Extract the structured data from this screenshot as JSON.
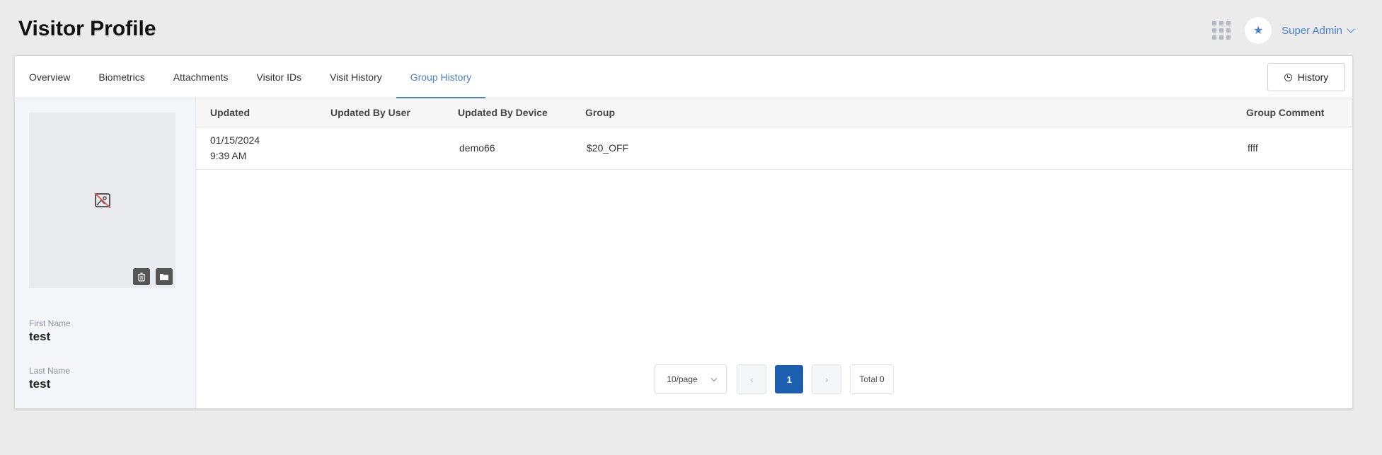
{
  "page": {
    "title": "Visitor Profile"
  },
  "topbar": {
    "apps_icon": "grid-icon",
    "favorite_icon": "star-icon",
    "user_label": "Super Admin"
  },
  "tabs": [
    {
      "label": "Overview"
    },
    {
      "label": "Biometrics"
    },
    {
      "label": "Attachments"
    },
    {
      "label": "Visitor IDs"
    },
    {
      "label": "Visit History"
    },
    {
      "label": "Group History",
      "active": true
    }
  ],
  "history_button": {
    "label": "History",
    "icon": "history-icon"
  },
  "profile": {
    "photo_icon": "no-image-icon",
    "first_name_label": "First Name",
    "first_name": "test",
    "last_name_label": "Last Name",
    "last_name": "test"
  },
  "table": {
    "columns": [
      "Updated",
      "Updated By User",
      "Updated By Device",
      "Group",
      "Group Comment"
    ],
    "rows": [
      {
        "updated_date": "01/15/2024",
        "updated_time": "9:39 AM",
        "updated_by_user": "",
        "updated_by_device": "demo66",
        "group": "$20_OFF",
        "group_comment": "ffff"
      }
    ]
  },
  "pagination": {
    "page_size": "10/page",
    "current_page": "1",
    "total": "Total 0"
  },
  "colors": {
    "accent": "#4a7fd1",
    "active_page": "#1c5fb0"
  }
}
